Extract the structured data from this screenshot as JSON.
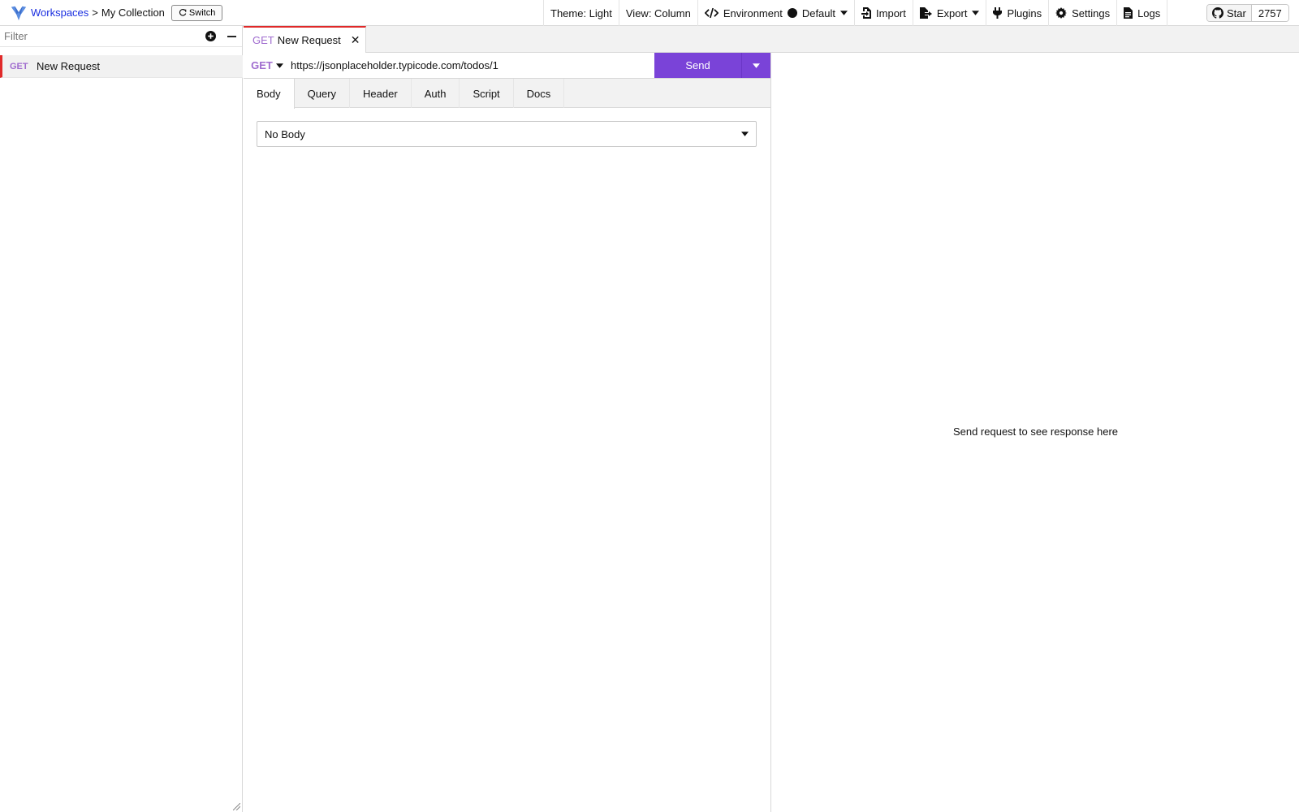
{
  "breadcrumb": {
    "workspaces_label": "Workspaces",
    "separator": ">",
    "collection_name": "My Collection",
    "switch_label": "Switch"
  },
  "toolbar": {
    "theme_label": "Theme: Light",
    "view_label": "View: Column",
    "environment_label": "Environment",
    "environment_value": "Default",
    "import_label": "Import",
    "export_label": "Export",
    "plugins_label": "Plugins",
    "settings_label": "Settings",
    "logs_label": "Logs"
  },
  "github": {
    "star_label": "Star",
    "star_count": "2757"
  },
  "sidebar": {
    "filter_placeholder": "Filter",
    "items": [
      {
        "method": "GET",
        "label": "New Request"
      }
    ]
  },
  "tabs": [
    {
      "method": "GET",
      "label": "New Request",
      "close_glyph": "✕"
    }
  ],
  "request": {
    "method": "GET",
    "url": "https://jsonplaceholder.typicode.com/todos/1",
    "send_label": "Send",
    "sub_tabs": [
      "Body",
      "Query",
      "Header",
      "Auth",
      "Script",
      "Docs"
    ],
    "active_sub_tab": "Body",
    "body_type": "No Body"
  },
  "response": {
    "hint": "Send request to see response here"
  },
  "colors": {
    "accent": "#7a43d8",
    "method_get": "#a06ccf",
    "active_indicator": "#e02929",
    "link": "#1a2ee0"
  },
  "icons": {
    "logo": "whale-logo-icon",
    "switch": "refresh-icon",
    "environment": "code-icon",
    "import": "file-import-icon",
    "export": "file-export-icon",
    "plugins": "plug-icon",
    "settings": "gear-icon",
    "logs": "file-text-icon",
    "github": "github-icon",
    "add": "plus-circle-icon",
    "collapse": "minus-icon"
  }
}
